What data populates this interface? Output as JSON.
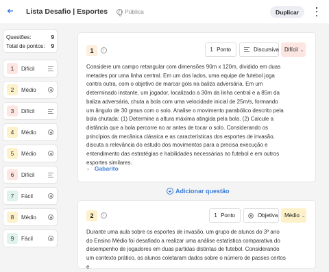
{
  "header": {
    "back_icon": "arrow-left-icon",
    "title": "Lista Desafio | Esportes de ...",
    "visibility": "Pública",
    "duplicate_label": "Duplicar",
    "more_icon": "kebab-menu-icon"
  },
  "sidebar": {
    "questions_label": "Questões:",
    "questions_count": "9",
    "points_label": "Total de pontos:",
    "points_count": "9",
    "items": [
      {
        "num": "1",
        "level": "Difícil",
        "icon": "text-lines-icon",
        "color": "#fde6e2"
      },
      {
        "num": "2",
        "level": "Médio",
        "icon": "radio-icon",
        "color": "#fdf1c9"
      },
      {
        "num": "3",
        "level": "Difícil",
        "icon": "text-lines-icon",
        "color": "#fde6e2"
      },
      {
        "num": "4",
        "level": "Médio",
        "icon": "radio-icon",
        "color": "#fdf1c9"
      },
      {
        "num": "5",
        "level": "Médio",
        "icon": "radio-icon",
        "color": "#fdf1c9"
      },
      {
        "num": "6",
        "level": "Difícil",
        "icon": "text-lines-icon",
        "color": "#fde6e2"
      },
      {
        "num": "7",
        "level": "Fácil",
        "icon": "radio-icon",
        "color": "#dff2ec"
      },
      {
        "num": "8",
        "level": "Médio",
        "icon": "radio-icon",
        "color": "#fdf1c9"
      },
      {
        "num": "9",
        "level": "Fácil",
        "icon": "radio-icon",
        "color": "#dff2ec"
      }
    ]
  },
  "questions": [
    {
      "num": "1",
      "points_value": "1",
      "points_label": "Ponto",
      "type": "Discursiva",
      "difficulty": "Difícil",
      "difficulty_color": "#fde6e2",
      "text": "Considere um campo retangular com dimensões 90m x 120m, dividido em duas metades por uma linha central. Em um dos lados, uma equipe de futebol joga contra outra, com o objetivo de marcar gols na baliza adversária. Em um determinado instante, um jogador, localizado a 30m da linha central e a 85m da baliza adversária, chuta a bola com uma velocidade inicial de 25m/s, formando um ângulo de 30 graus com o solo. Analise o movimento parabólico descrito pela bola chutada: (1) Determine a altura máxima atingida pela bola. (2) Calcule a distância que a bola percorre no ar antes de tocar o solo. Considerando os princípios da mecânica clássica e as características dos esportes de invasão, discuta a relevância do estudo dos movimentos para a precisa execução e entendimento das estratégias e habilidades necessárias no futebol e em outros esportes similares.",
      "answer_label": "Gabarito"
    },
    {
      "num": "2",
      "points_value": "1",
      "points_label": "Ponto",
      "type": "Objetiva",
      "difficulty": "Médio",
      "difficulty_color": "#fdf1c9",
      "text": "Durante uma aula sobre os esportes de invasão, um grupo de alunos do 3º ano do Ensino Médio foi desafiado a realizar uma análise estatística comparativa do desempenho de jogadores em duas partidas distintas de futebol. Considerando um contexto prático, os alunos coletaram dados sobre o número de passes certos e"
    }
  ],
  "add_question_label": "Adicionar questão"
}
